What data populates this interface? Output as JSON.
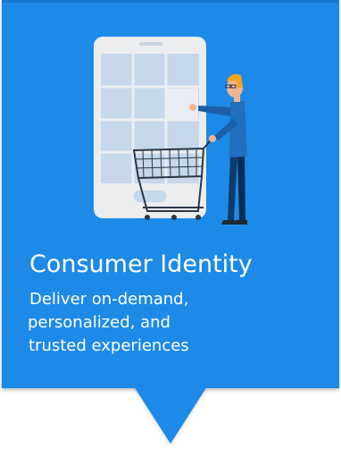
{
  "card": {
    "title": "Consumer Identity",
    "description_lines": [
      "Deliver on-demand,",
      "personalized, and",
      "trusted experiences"
    ],
    "background_color": "#1d8ae8"
  },
  "illustration": {
    "icon": "person-with-shopping-cart-using-phone-icon"
  }
}
